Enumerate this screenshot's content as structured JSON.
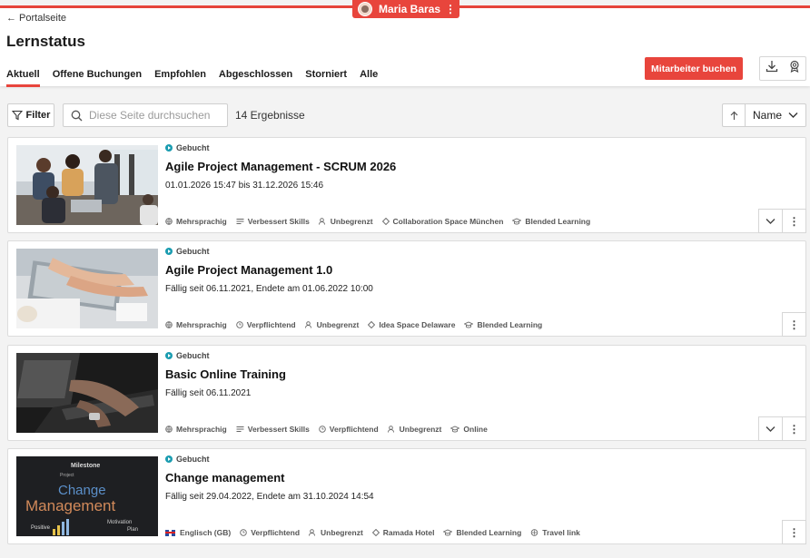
{
  "header": {
    "back_label": "← Portalseite",
    "title": "Lernstatus",
    "tabs": [
      "Aktuell",
      "Offene Buchungen",
      "Empfohlen",
      "Abgeschlossen",
      "Storniert",
      "Alle"
    ],
    "primary_button": "Mitarbeiter buchen"
  },
  "user": {
    "name": "Maria Baras"
  },
  "toolbar": {
    "filter_label": "Filter",
    "search_placeholder": "Diese Seite durchsuchen",
    "results": "14 Ergebnisse",
    "sort_label": "Name"
  },
  "colors": {
    "accent": "#e8453c",
    "status_dot": "#1a9cb0"
  },
  "courses": [
    {
      "status": "Gebucht",
      "title": "Agile Project Management - SCRUM 2026",
      "date": "01.01.2026 15:47 bis 31.12.2026 15:46",
      "meta": [
        "Mehrsprachig",
        "Verbessert Skills",
        "Unbegrenzt",
        "Collaboration Space München",
        "Blended Learning"
      ]
    },
    {
      "status": "Gebucht",
      "title": "Agile Project Management 1.0",
      "date": "Fällig seit 06.11.2021, Endete am 01.06.2022 10:00",
      "meta": [
        "Mehrsprachig",
        "Verpflichtend",
        "Unbegrenzt",
        "Idea Space Delaware",
        "Blended Learning"
      ]
    },
    {
      "status": "Gebucht",
      "title": "Basic Online Training",
      "date": "Fällig seit 06.11.2021",
      "meta": [
        "Mehrsprachig",
        "Verbessert Skills",
        "Verpflichtend",
        "Unbegrenzt",
        "Online"
      ]
    },
    {
      "status": "Gebucht",
      "title": "Change management",
      "date": "Fällig seit 29.04.2022, Endete am 31.10.2024 14:54",
      "meta": [
        "Englisch (GB)",
        "Verpflichtend",
        "Unbegrenzt",
        "Ramada Hotel",
        "Blended Learning",
        "Travel link"
      ]
    }
  ],
  "thumb_words": [
    "Change",
    "Management",
    "Milestone",
    "Project",
    "Motivation",
    "Plan",
    "Positive"
  ]
}
